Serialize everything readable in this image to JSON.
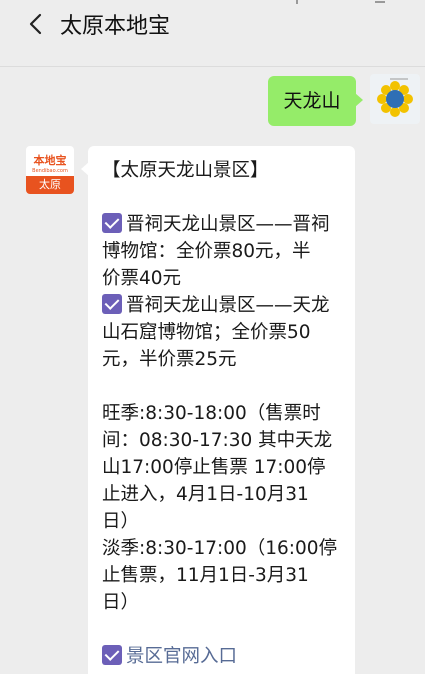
{
  "header": {
    "title": "太原本地宝"
  },
  "messages": {
    "sent": {
      "text": "天龙山"
    },
    "reply_avatar": {
      "brand": "本地宝",
      "url": "Bendibao.com",
      "city": "太原"
    },
    "reply": {
      "lines": [
        "【太原天龙山景区】",
        "晋祠天龙山景区——晋祠",
        "博物馆：全价票80元，半",
        "价票40元",
        "晋祠天龙山景区——天龙",
        "山石窟博物馆；全价票50",
        "元，半价票25元",
        "旺季:8:30-18:00（售票时",
        "间：08:30-17:30 其中天龙",
        "山17:00停止售票 17:00停",
        "止进入，4月1日-10月31",
        "日）",
        "淡季:8:30-17:00（16:00停",
        "止售票，11月1日-3月31",
        "日）",
        "景区官网入口"
      ]
    }
  },
  "colors": {
    "sent_bubble": "#95ec69",
    "checkbox": "#6c5fb8",
    "link": "#576b95",
    "brand": "#e8531f"
  },
  "icons": {
    "back": "chevron-left-icon",
    "check": "checkbox-icon"
  }
}
